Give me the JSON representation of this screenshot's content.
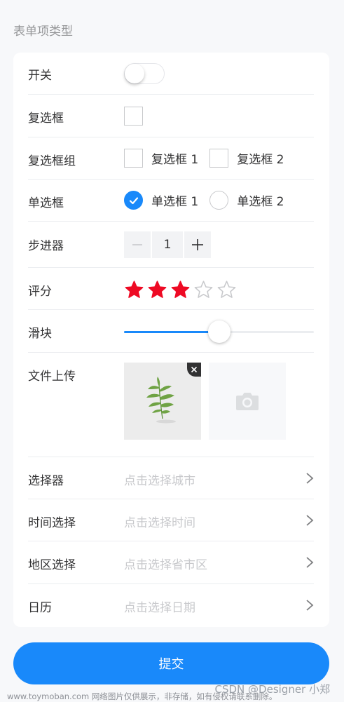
{
  "section_title": "表单项类型",
  "rows": {
    "switch": {
      "label": "开关"
    },
    "checkbox": {
      "label": "复选框"
    },
    "checkbox_group": {
      "label": "复选框组",
      "options": [
        "复选框 1",
        "复选框 2"
      ]
    },
    "radio": {
      "label": "单选框",
      "options": [
        "单选框 1",
        "单选框 2"
      ]
    },
    "stepper": {
      "label": "步进器",
      "value": "1"
    },
    "rate": {
      "label": "评分",
      "value": 3,
      "max": 5
    },
    "slider": {
      "label": "滑块",
      "value_fraction": 0.5
    },
    "uploader": {
      "label": "文件上传"
    },
    "picker": {
      "label": "选择器",
      "placeholder": "点击选择城市"
    },
    "time": {
      "label": "时间选择",
      "placeholder": "点击选择时间"
    },
    "area": {
      "label": "地区选择",
      "placeholder": "点击选择省市区"
    },
    "calendar": {
      "label": "日历",
      "placeholder": "点击选择日期"
    }
  },
  "submit_label": "提交",
  "watermark": "www.toymoban.com 网络图片仅供展示，非存储，如有侵权请联系删除。",
  "csdn_mark": "CSDN @Designer 小郑",
  "colors": {
    "primary": "#1989fa",
    "star": "#ee0a24",
    "placeholder": "#c8c9cc"
  }
}
